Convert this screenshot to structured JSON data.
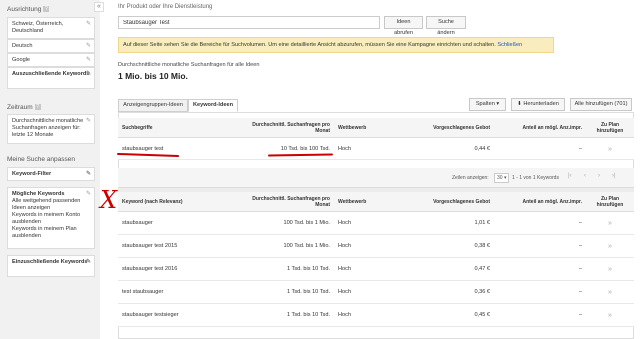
{
  "sidebar": {
    "targeting_title": "Ausrichtung",
    "help_mark": "?",
    "collapse_label": "«",
    "targeting_items": [
      "Schweiz, Österreich, Deutschland",
      "Deutsch",
      "Google",
      "Auszuschließende Keywords"
    ],
    "period_title": "Zeitraum",
    "period_text": "Durchschnittliche monatliche Suchanfragen anzeigen für: letzte 12 Monate",
    "refine_title": "Meine Suche anpassen",
    "keyword_filter": "Keyword-Filter",
    "possible_keywords_title": "Mögliche Keywords",
    "possible_keywords_options": [
      "Alle weitgehend passenden Ideen anzeigen",
      "Keywords in meinem Konto ausblenden",
      "Keywords in meinem Plan ausblenden"
    ],
    "include_exclude": "Einzuschließende Keywords"
  },
  "main": {
    "product_label": "Ihr Produkt oder Ihre Dienstleistung",
    "search_value": "Staubsauger Test",
    "btn_get_ideas": "Ideen abrufen",
    "btn_change_search": "Suche ändern",
    "notice_text": "Auf dieser Seite sehen Sie die Bereiche für Suchvolumen. Um eine detaillierte Ansicht abzurufen, müssen Sie eine Kampagne einrichten und schalten.",
    "notice_close": "Schließen",
    "volume_label": "Durchschnittliche monatliche Suchanfragen für alle Ideen",
    "volume_value": "1 Mio. bis 10 Mio.",
    "tab_adgroups": "Anzeigengruppen-Ideen",
    "tab_keywords": "Keyword-Ideen",
    "btn_columns": "Spalten ▾",
    "btn_download": "Herunterladen",
    "btn_add_all": "Alle hinzufügen (701)"
  },
  "search_table": {
    "headers": [
      "Suchbegriffe",
      "Durchschnittl. Suchanfragen pro Monat",
      "Wettbewerb",
      "Vorgeschlagenes Gebot",
      "Anteil an mögl. Anz.impr.",
      "Zu Plan hinzufügen"
    ],
    "row": {
      "term": "staubsauger test",
      "volume": "10 Tsd. bis 100 Tsd.",
      "competition": "Hoch",
      "bid": "0,44 €",
      "share": "–",
      "add": "»"
    }
  },
  "pager": {
    "show_label": "Zeilen anzeigen:",
    "rows_value": "30 ▾",
    "range": "1 - 1 von 1 Keywords",
    "nav_icons": [
      "|‹",
      "‹",
      "›",
      "›|"
    ]
  },
  "keyword_table": {
    "headers": [
      "Keyword (nach Relevanz)",
      "Durchschnittl. Suchanfragen pro Monat",
      "Wettbewerb",
      "Vorgeschlagenes Gebot",
      "Anteil an mögl. Anz.impr.",
      "Zu Plan hinzufügen"
    ],
    "rows": [
      {
        "keyword": "staubsauger",
        "volume": "100 Tsd. bis 1 Mio.",
        "competition": "Hoch",
        "bid": "1,01 €",
        "share": "–",
        "add": "»"
      },
      {
        "keyword": "staubsauger test 2015",
        "volume": "100 Tsd. bis 1 Mio.",
        "competition": "Hoch",
        "bid": "0,38 €",
        "share": "–",
        "add": "»"
      },
      {
        "keyword": "staubsauger test 2016",
        "volume": "1 Tsd. bis 10 Tsd.",
        "competition": "Hoch",
        "bid": "0,47 €",
        "share": "–",
        "add": "»"
      },
      {
        "keyword": "test staubsauger",
        "volume": "1 Tsd. bis 10 Tsd.",
        "competition": "Hoch",
        "bid": "0,36 €",
        "share": "–",
        "add": "»"
      },
      {
        "keyword": "staubsauger testsieger",
        "volume": "1 Tsd. bis 10 Tsd.",
        "competition": "Hoch",
        "bid": "0,45 €",
        "share": "–",
        "add": "»"
      }
    ]
  },
  "annotations": {
    "cross_mark": "X",
    "color": "#cc0000"
  },
  "colors": {
    "notice_bg": "#f9edbe",
    "sidebar_bg": "#f1f1f1",
    "link": "#1155cc"
  }
}
